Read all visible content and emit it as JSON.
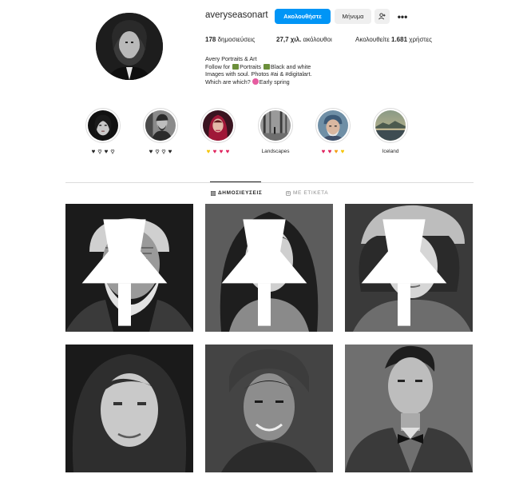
{
  "profile": {
    "username": "averyseasonart",
    "follow_label": "Ακολουθήστε",
    "message_label": "Μήνυμα",
    "more_label": "•••",
    "stats": {
      "posts_count": "178",
      "posts_label": "δημοσιεύσεις",
      "followers_count": "27,7 χιλ.",
      "followers_label": "ακόλουθοι",
      "following_prefix": "Ακολουθείτε",
      "following_count": "1.681",
      "following_label": "χρήστες"
    },
    "bio": {
      "name": "Avery Portraits & Art",
      "line1_a": "Follow for",
      "line1_b": "Portraits",
      "line1_c": "Black and white",
      "line2": "Images with soul. Photos #ai & #digitalart.",
      "line3_a": "Which are which?",
      "line3_b": "Early spring"
    }
  },
  "highlights": [
    {
      "label": "",
      "hearts": [
        "#262626",
        "#ffffff",
        "#262626",
        "#ffffff"
      ]
    },
    {
      "label": "",
      "hearts": [
        "#262626",
        "#ffffff",
        "#ffffff",
        "#262626"
      ]
    },
    {
      "label": "",
      "hearts": [
        "#f5c400",
        "#e0245e",
        "#e0245e",
        "#e0245e"
      ]
    },
    {
      "label": "Landscapes",
      "hearts": []
    },
    {
      "label": "",
      "hearts": [
        "#e0245e",
        "#e0245e",
        "#f39c12",
        "#f5c400"
      ]
    },
    {
      "label": "Iceland",
      "hearts": []
    }
  ],
  "tabs": {
    "posts": "ΔΗΜΟΣΙΕΥΣΕΙΣ",
    "tagged": "ΜΕ ΕΤΙΚΕΤΑ"
  },
  "colors": {
    "accent": "#0095f6",
    "text": "#262626",
    "muted": "#8e8e8e",
    "border": "#dbdbdb"
  },
  "icons": {
    "suggest": "add-person-icon",
    "pin": "pin-icon",
    "grid": "grid-icon",
    "tag": "tag-icon"
  }
}
